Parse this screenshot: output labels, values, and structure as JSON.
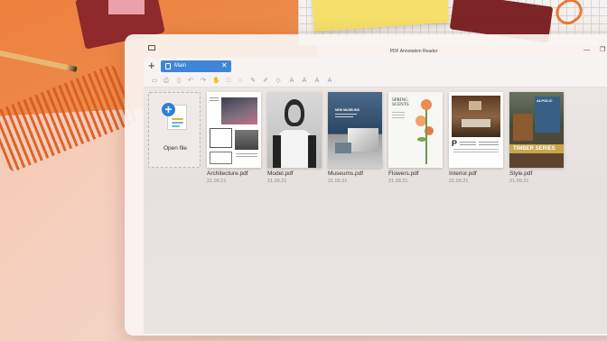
{
  "window": {
    "title": "PDF Annotation Reader"
  },
  "tabs": [
    {
      "label": "Main"
    }
  ],
  "add_tab_symbol": "+",
  "close_tab_symbol": "✕",
  "open_file": {
    "label": "Open file",
    "plus": "+"
  },
  "toolbar_icons": [
    "save-icon",
    "print-icon",
    "bookmark-icon",
    "undo-icon",
    "redo-icon",
    "hand-icon",
    "rectangle-icon",
    "circle-icon",
    "pen-icon",
    "highlighter-icon",
    "eraser-icon",
    "text-icon",
    "text-size-icon",
    "text-style-icon",
    "text-format-icon"
  ],
  "files": [
    {
      "name": "Architecture.pdf",
      "date": "21.09.21"
    },
    {
      "name": "Model.pdf",
      "date": "21.09.21"
    },
    {
      "name": "Museums.pdf",
      "date": "21.09.21"
    },
    {
      "name": "Flowers.pdf",
      "date": "21.09.21"
    },
    {
      "name": "Interior.pdf",
      "date": "21.09.21"
    },
    {
      "name": "Style.pdf",
      "date": "21.09.21"
    }
  ],
  "thumb_text": {
    "museums_heading": "NEW MUSEUMS",
    "flowers_heading": "SPRING SCENTS",
    "style_brand": "ALPOLIC",
    "style_banner": "TIMBER SERIES",
    "interior_letter": "P"
  },
  "window_controls": {
    "minimize": "—",
    "restore": "❐"
  },
  "colors": {
    "accent": "#3f86d8",
    "plus": "#2f7fd6"
  }
}
